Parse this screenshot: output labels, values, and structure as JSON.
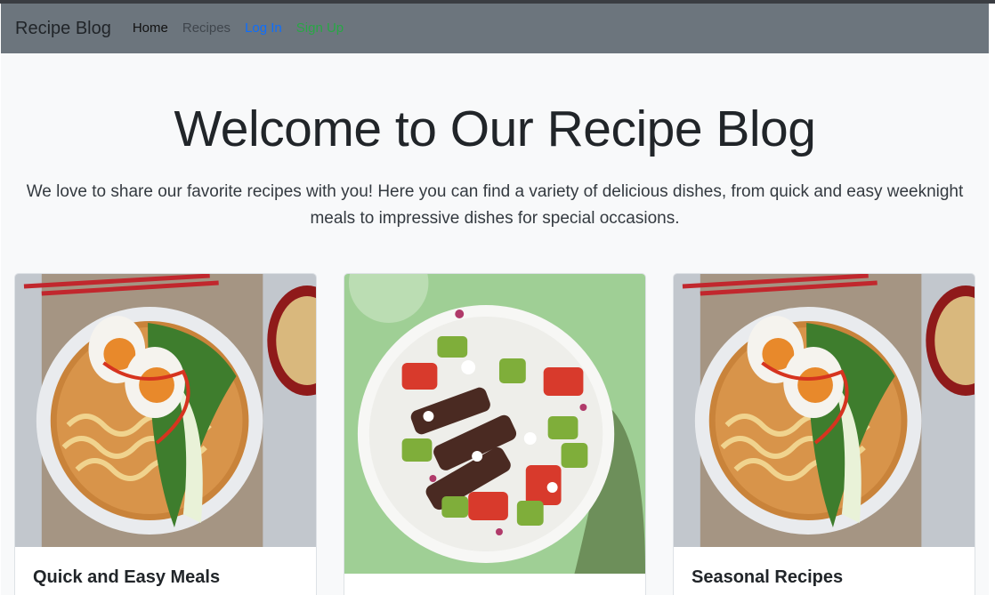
{
  "navbar": {
    "brand": "Recipe Blog",
    "links": [
      {
        "label": "Home"
      },
      {
        "label": "Recipes"
      },
      {
        "label": "Log In"
      },
      {
        "label": "Sign Up"
      }
    ],
    "colors": {
      "background": "#6c757d",
      "login": "#0d6efd",
      "signup": "#28a745"
    }
  },
  "hero": {
    "title": "Welcome to Our Recipe Blog",
    "text": "We love to share our favorite recipes with you! Here you can find a variety of delicious dishes, from quick and easy weeknight meals to impressive dishes for special occasions."
  },
  "cards": [
    {
      "title": "Quick and Easy Meals",
      "image": "ramen-bowl-photo"
    },
    {
      "title": "",
      "image": "steak-salad-photo"
    },
    {
      "title": "Seasonal Recipes",
      "image": "ramen-bowl-photo"
    }
  ]
}
